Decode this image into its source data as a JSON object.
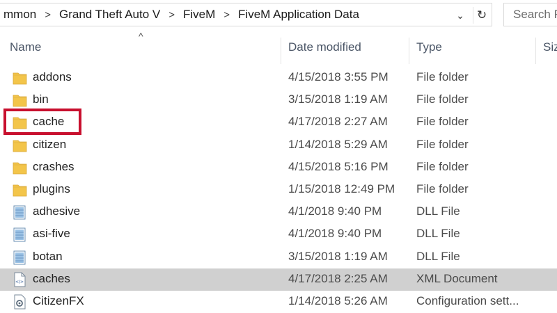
{
  "address": {
    "crumbs": [
      "mmon",
      "Grand Theft Auto V",
      "FiveM",
      "FiveM Application Data"
    ],
    "dropdown_icon": "chevron-down-icon",
    "refresh_icon": "refresh-icon"
  },
  "search": {
    "placeholder": "Search Fi"
  },
  "columns": {
    "name": "Name",
    "date": "Date modified",
    "type": "Type",
    "size": "Siz"
  },
  "files": [
    {
      "name": "addons",
      "date": "4/15/2018 3:55 PM",
      "type": "File folder",
      "icon": "folder-icon"
    },
    {
      "name": "bin",
      "date": "3/15/2018 1:19 AM",
      "type": "File folder",
      "icon": "folder-icon"
    },
    {
      "name": "cache",
      "date": "4/17/2018 2:27 AM",
      "type": "File folder",
      "icon": "folder-icon"
    },
    {
      "name": "citizen",
      "date": "1/14/2018 5:29 AM",
      "type": "File folder",
      "icon": "folder-icon"
    },
    {
      "name": "crashes",
      "date": "4/15/2018 5:16 PM",
      "type": "File folder",
      "icon": "folder-icon"
    },
    {
      "name": "plugins",
      "date": "1/15/2018 12:49 PM",
      "type": "File folder",
      "icon": "folder-icon"
    },
    {
      "name": "adhesive",
      "date": "4/1/2018 9:40 PM",
      "type": "DLL File",
      "icon": "dll-file-icon"
    },
    {
      "name": "asi-five",
      "date": "4/1/2018 9:40 PM",
      "type": "DLL File",
      "icon": "dll-file-icon"
    },
    {
      "name": "botan",
      "date": "3/15/2018 1:19 AM",
      "type": "DLL File",
      "icon": "dll-file-icon"
    },
    {
      "name": "caches",
      "date": "4/17/2018 2:25 AM",
      "type": "XML Document",
      "icon": "xml-file-icon",
      "selected": true
    },
    {
      "name": "CitizenFX",
      "date": "1/14/2018 5:26 AM",
      "type": "Configuration sett...",
      "icon": "config-file-icon"
    }
  ],
  "colors": {
    "highlight": "#c8102e",
    "folder": "#f3c54a",
    "selected_row": "#d0d0d0"
  }
}
